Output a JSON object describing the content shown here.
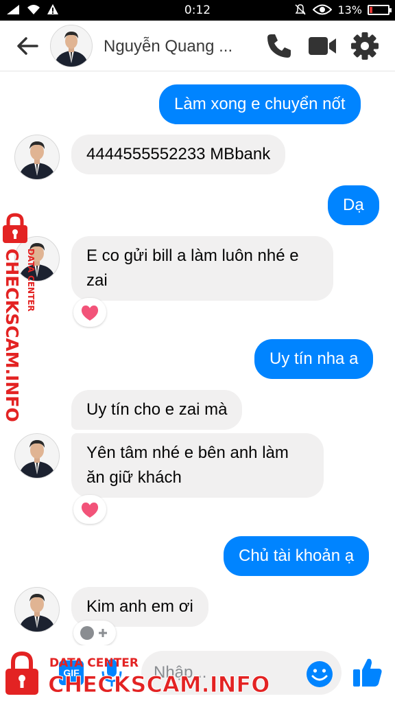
{
  "status_bar": {
    "time": "0:12",
    "battery": "13%"
  },
  "header": {
    "contact_name": "Nguyễn Quang ..."
  },
  "messages": [
    {
      "dir": "out",
      "text": "Làm xong e chuyển nốt"
    },
    {
      "dir": "in",
      "text": "4444555552233 MBbank"
    },
    {
      "dir": "out",
      "text": "Dạ"
    },
    {
      "dir": "in",
      "lines": [
        "E co gửi bill a làm luôn nhé e",
        "zai"
      ],
      "reaction": "heart"
    },
    {
      "dir": "out",
      "text": "Uy tín nha a"
    },
    {
      "dir": "in",
      "text": "Uy tín cho e zai mà"
    },
    {
      "dir": "in",
      "lines": [
        "Yên tâm nhé e bên anh làm",
        "ăn giữ khách"
      ],
      "reaction": "heart"
    },
    {
      "dir": "out",
      "text": "Chủ tài khoản ạ"
    },
    {
      "dir": "in",
      "text": "Kim anh em ơi",
      "reaction": "add-reaction"
    }
  ],
  "composer": {
    "placeholder": "Nhập...",
    "gif_label": "GIF"
  },
  "watermark": {
    "main": "CHECKSCAM.INFO",
    "sub": "DATA CENTER"
  },
  "colors": {
    "outgoing": "#0084ff",
    "incoming": "#f1f0f0",
    "watermark": "#e32323"
  },
  "icons": [
    "back-arrow-icon",
    "phone-icon",
    "video-camera-icon",
    "gear-icon",
    "mic-icon",
    "emoji-icon",
    "thumbs-up-icon",
    "heart-icon",
    "lock-icon"
  ]
}
